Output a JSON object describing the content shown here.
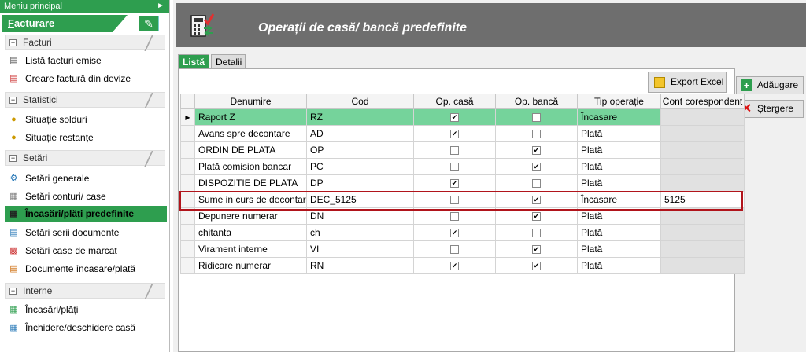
{
  "sidebar": {
    "header": "Meniu principal",
    "pin_icon": "pin-icon",
    "section_tab": "Facturare",
    "groups": [
      {
        "label": "Facturi",
        "items": [
          {
            "label": "Listă facturi emise",
            "icon": "list-icon"
          },
          {
            "label": "Creare factură din devize",
            "icon": "invoice-add-icon"
          }
        ]
      },
      {
        "label": "Statistici",
        "items": [
          {
            "label": "Situație solduri",
            "icon": "balance-icon"
          },
          {
            "label": "Situație restanțe",
            "icon": "arrears-icon"
          }
        ]
      },
      {
        "label": "Setări",
        "items": [
          {
            "label": "Setări generale",
            "icon": "gear-icon"
          },
          {
            "label": "Setări conturi/ case",
            "icon": "accounts-icon"
          },
          {
            "label": "Încasări/plăți predefinite",
            "icon": "calculator-icon",
            "active": true
          },
          {
            "label": "Setări serii documente",
            "icon": "documents-icon"
          },
          {
            "label": "Setări case de marcat",
            "icon": "cash-register-icon"
          },
          {
            "label": "Documente încasare/plată",
            "icon": "document-icon"
          }
        ]
      },
      {
        "label": "Interne",
        "items": [
          {
            "label": "Încasări/plăți",
            "icon": "payments-icon"
          },
          {
            "label": "Închidere/deschidere casă",
            "icon": "register-close-icon"
          }
        ]
      }
    ]
  },
  "page": {
    "title": "Operații de casă/ bancă predefinite",
    "tabs": [
      "Listă",
      "Detalii"
    ],
    "export_label": "Export Excel",
    "add_label": "Adăugare",
    "delete_label": "Ștergere"
  },
  "grid": {
    "columns": [
      "Denumire",
      "Cod",
      "Op. casă",
      "Op. bancă",
      "Tip operație",
      "Cont corespondent"
    ],
    "rows": [
      {
        "denumire": "Raport Z",
        "cod": "RZ",
        "casa": true,
        "banca": false,
        "tip": "Încasare",
        "cont": ""
      },
      {
        "denumire": "Avans spre decontare",
        "cod": "AD",
        "casa": true,
        "banca": false,
        "tip": "Plată",
        "cont": ""
      },
      {
        "denumire": "ORDIN DE PLATA",
        "cod": "OP",
        "casa": false,
        "banca": true,
        "tip": "Plată",
        "cont": ""
      },
      {
        "denumire": "Plată comision bancar",
        "cod": "PC",
        "casa": false,
        "banca": true,
        "tip": "Plată",
        "cont": ""
      },
      {
        "denumire": "DISPOZITIE DE PLATA",
        "cod": "DP",
        "casa": true,
        "banca": false,
        "tip": "Plată",
        "cont": ""
      },
      {
        "denumire": "Sume in curs de decontar",
        "cod": "DEC_5125",
        "casa": false,
        "banca": true,
        "tip": "Încasare",
        "cont": "5125"
      },
      {
        "denumire": "Depunere numerar",
        "cod": "DN",
        "casa": false,
        "banca": true,
        "tip": "Plată",
        "cont": ""
      },
      {
        "denumire": "chitanta",
        "cod": "ch",
        "casa": true,
        "banca": false,
        "tip": "Plată",
        "cont": ""
      },
      {
        "denumire": "Virament interne",
        "cod": "VI",
        "casa": false,
        "banca": true,
        "tip": "Plată",
        "cont": ""
      },
      {
        "denumire": "Ridicare numerar",
        "cod": "RN",
        "casa": true,
        "banca": true,
        "tip": "Plată",
        "cont": ""
      }
    ],
    "selected_row_indicator": "▶"
  },
  "colors": {
    "accent_green": "#2e9e4f",
    "selected_row": "#75d39b",
    "banner": "#6e6e6e",
    "highlight_border": "#b1141b"
  }
}
